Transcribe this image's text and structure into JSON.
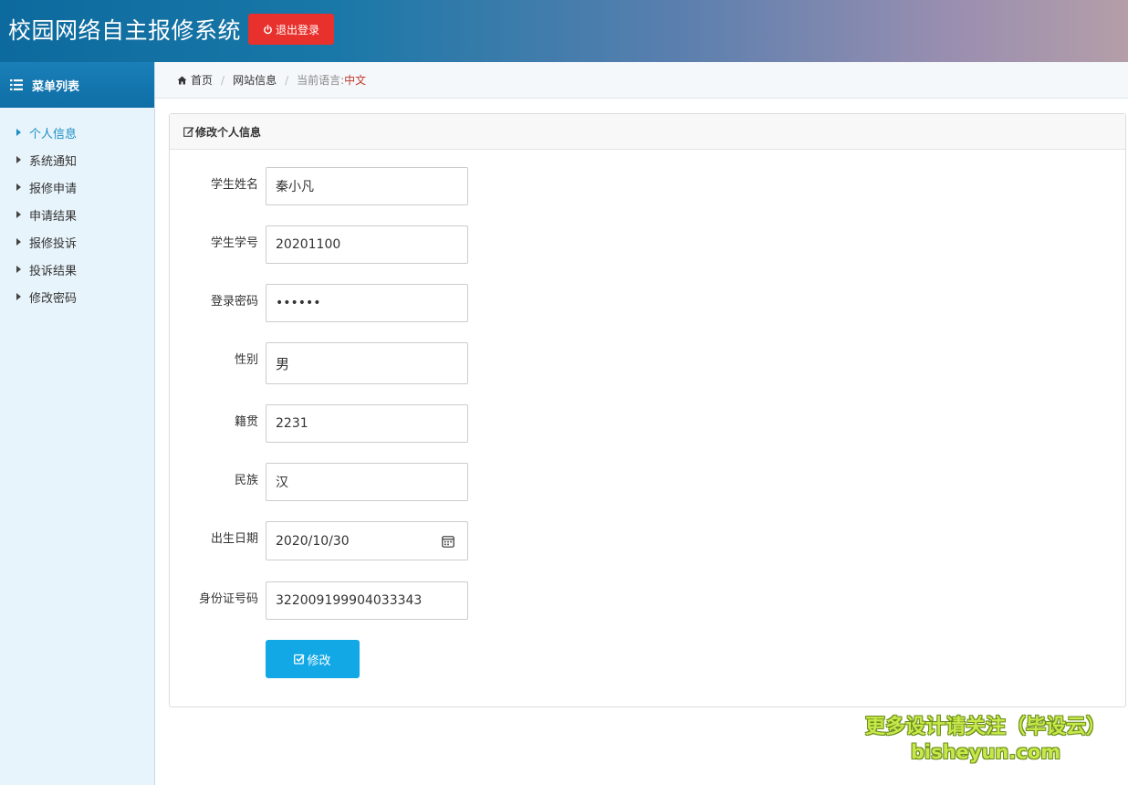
{
  "header": {
    "title": "校园网络自主报修系统",
    "logout_label": "退出登录"
  },
  "sidebar": {
    "title": "菜单列表",
    "items": [
      {
        "label": "个人信息"
      },
      {
        "label": "系统通知"
      },
      {
        "label": "报修申请"
      },
      {
        "label": "申请结果"
      },
      {
        "label": "报修投诉"
      },
      {
        "label": "投诉结果"
      },
      {
        "label": "修改密码"
      }
    ]
  },
  "breadcrumb": {
    "home": "首页",
    "site_info": "网站信息",
    "lang_label": "当前语言:",
    "lang_value": "中文"
  },
  "form": {
    "heading": "修改个人信息",
    "fields": [
      {
        "label": "学生姓名",
        "value": "秦小凡"
      },
      {
        "label": "学生学号",
        "value": "20201100"
      },
      {
        "label": "登录密码",
        "value": "••••••"
      },
      {
        "label": "性别",
        "value": "男"
      },
      {
        "label": "籍贯",
        "value": "2231"
      },
      {
        "label": "民族",
        "value": "汉"
      },
      {
        "label": "出生日期",
        "value": "2020/10/30"
      },
      {
        "label": "身份证号码",
        "value": "322009199904033343"
      }
    ],
    "submit_label": "修改"
  },
  "watermark": {
    "line1": "更多设计请关注（毕设云）",
    "line2": "bisheyun.com"
  },
  "colors": {
    "accent": "#1a8fc5",
    "logout": "#e8302c",
    "submit": "#12a8e6",
    "language": "#c0392b"
  }
}
